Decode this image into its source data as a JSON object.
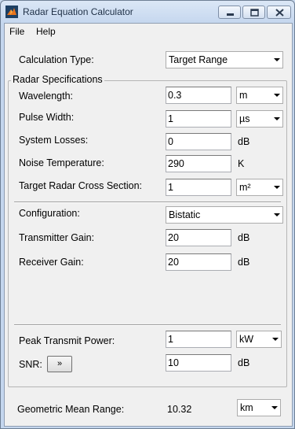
{
  "window": {
    "title": "Radar Equation Calculator"
  },
  "menu": {
    "file": "File",
    "help": "Help"
  },
  "calc_type": {
    "label": "Calculation Type:",
    "value": "Target Range"
  },
  "group": {
    "title": "Radar Specifications"
  },
  "wavelength": {
    "label": "Wavelength:",
    "value": "0.3",
    "unit": "m"
  },
  "pulse_width": {
    "label": "Pulse Width:",
    "value": "1",
    "unit": "µs"
  },
  "system_losses": {
    "label": "System Losses:",
    "value": "0",
    "unit": "dB"
  },
  "noise_temp": {
    "label": "Noise Temperature:",
    "value": "290",
    "unit": "K"
  },
  "rcs": {
    "label": "Target Radar Cross Section:",
    "value": "1",
    "unit": "m²"
  },
  "configuration": {
    "label": "Configuration:",
    "value": "Bistatic"
  },
  "tx_gain": {
    "label": "Transmitter Gain:",
    "value": "20",
    "unit": "dB"
  },
  "rx_gain": {
    "label": "Receiver Gain:",
    "value": "20",
    "unit": "dB"
  },
  "peak_power": {
    "label": "Peak Transmit Power:",
    "value": "1",
    "unit": "kW"
  },
  "snr": {
    "label": "SNR:",
    "button": "»",
    "value": "10",
    "unit": "dB"
  },
  "result": {
    "label": "Geometric Mean Range:",
    "value": "10.32",
    "unit": "km"
  }
}
